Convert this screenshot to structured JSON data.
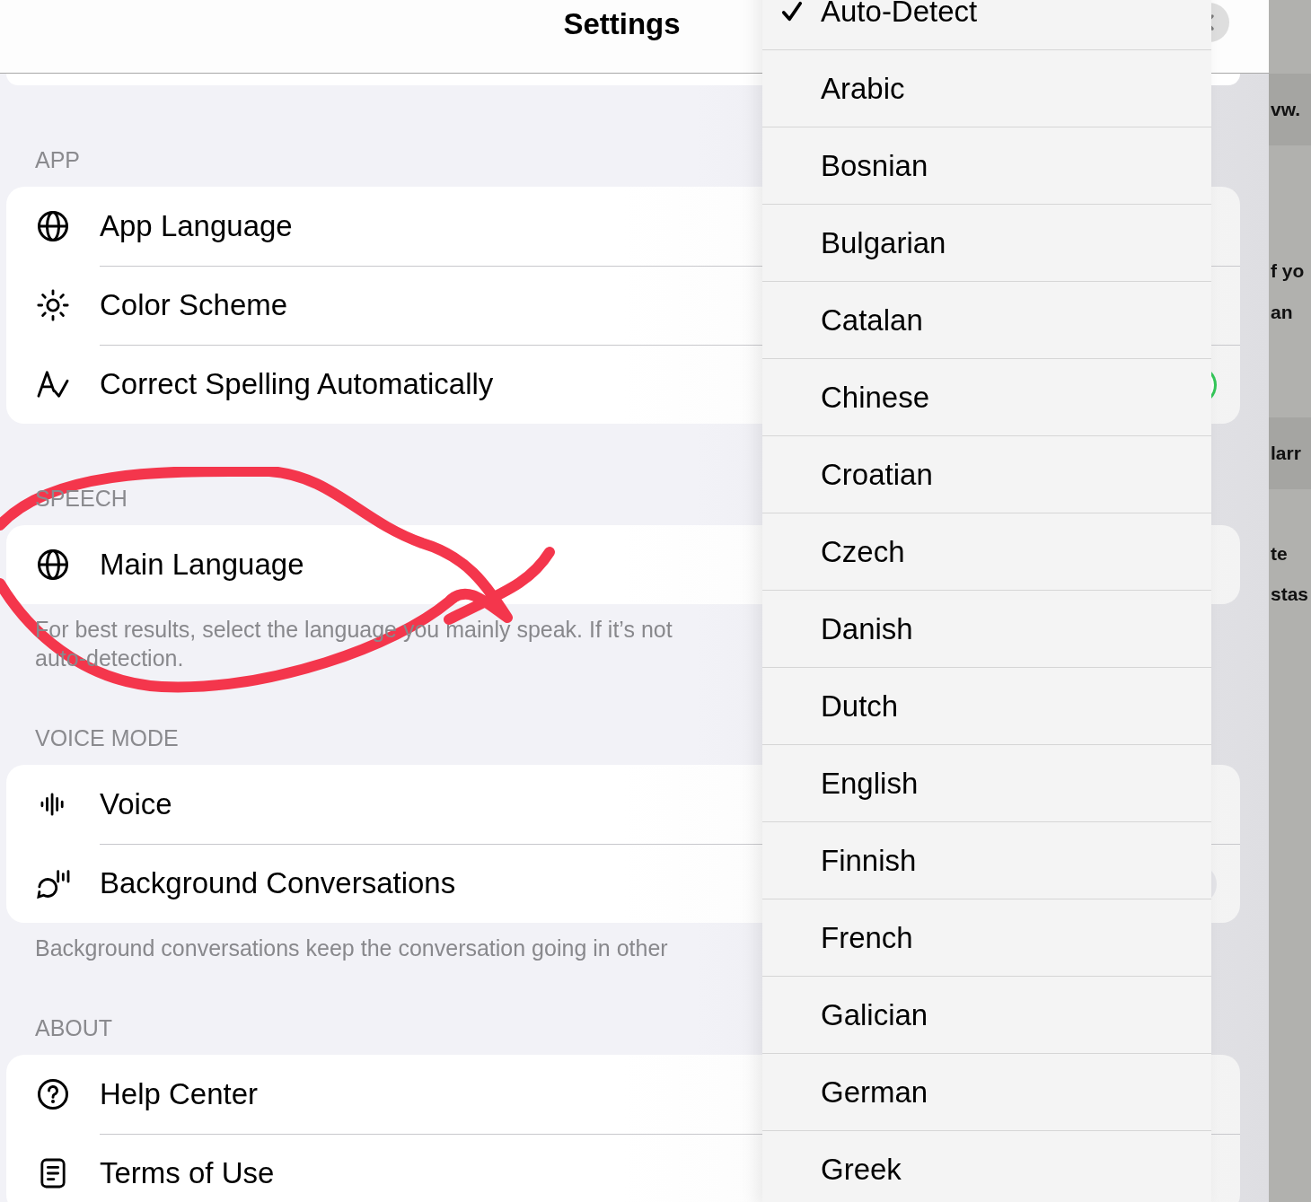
{
  "header": {
    "title": "Settings"
  },
  "sections": [
    {
      "label": "APP",
      "rows": [
        {
          "label": "App Language"
        },
        {
          "label": "Color Scheme"
        },
        {
          "label": "Correct Spelling Automatically",
          "on": true
        }
      ]
    },
    {
      "label": "SPEECH",
      "rows": [
        {
          "label": "Main Language"
        }
      ],
      "footnote": [
        "For best results, select the language you mainly speak. If it’s not",
        "auto-detection."
      ]
    },
    {
      "label": "VOICE MODE",
      "rows": [
        {
          "label": "Voice"
        },
        {
          "label": "Background Conversations",
          "on": false
        }
      ],
      "footnote": [
        "Background conversations keep the conversation going in other"
      ]
    },
    {
      "label": "ABOUT",
      "rows": [
        {
          "label": "Help Center"
        },
        {
          "label": "Terms of Use"
        }
      ]
    }
  ],
  "menu": {
    "items": [
      {
        "label": "Auto-Detect",
        "checked": true
      },
      {
        "label": "Arabic",
        "checked": false
      },
      {
        "label": "Bosnian",
        "checked": false
      },
      {
        "label": "Bulgarian",
        "checked": false
      },
      {
        "label": "Catalan",
        "checked": false
      },
      {
        "label": "Chinese",
        "checked": false
      },
      {
        "label": "Croatian",
        "checked": false
      },
      {
        "label": "Czech",
        "checked": false
      },
      {
        "label": "Danish",
        "checked": false
      },
      {
        "label": "Dutch",
        "checked": false
      },
      {
        "label": "English",
        "checked": false
      },
      {
        "label": "Finnish",
        "checked": false
      },
      {
        "label": "French",
        "checked": false
      },
      {
        "label": "Galician",
        "checked": false
      },
      {
        "label": "German",
        "checked": false
      },
      {
        "label": "Greek",
        "checked": false
      }
    ]
  },
  "background_page": {
    "fragments": [
      {
        "text": "vw.",
        "kind": "band"
      },
      {
        "text": "f yo",
        "kind": "plain"
      },
      {
        "text": "an",
        "kind": "plain"
      },
      {
        "text": "larr",
        "kind": "band"
      },
      {
        "text": "te",
        "kind": "plain"
      },
      {
        "text": "stas",
        "kind": "plain"
      }
    ]
  }
}
